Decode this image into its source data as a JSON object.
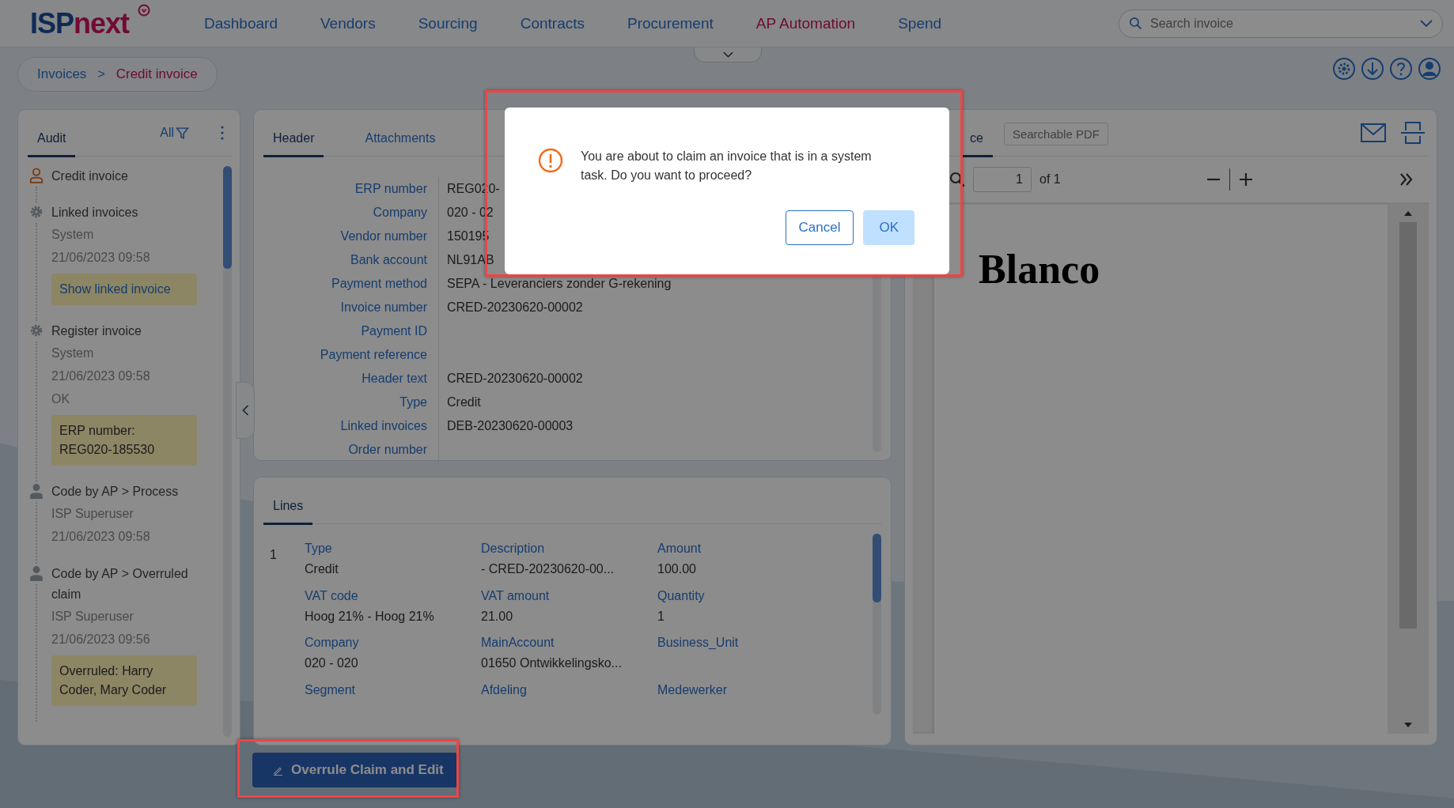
{
  "logo": {
    "brand": "ISP",
    "suffix": "next"
  },
  "nav": [
    {
      "label": "Dashboard",
      "selected": false
    },
    {
      "label": "Vendors",
      "selected": false
    },
    {
      "label": "Sourcing",
      "selected": false
    },
    {
      "label": "Contracts",
      "selected": false
    },
    {
      "label": "Procurement",
      "selected": false
    },
    {
      "label": "AP Automation",
      "selected": true
    },
    {
      "label": "Spend",
      "selected": false
    }
  ],
  "search": {
    "placeholder": "Search invoice"
  },
  "breadcrumb": [
    {
      "label": "Invoices",
      "selected": false
    },
    {
      "label": "Credit invoice",
      "selected": true
    }
  ],
  "breadcrumb_separator": ">",
  "audit": {
    "tab": "Audit",
    "filter": "All",
    "items": [
      {
        "kind": "user",
        "title": "Credit invoice"
      },
      {
        "kind": "system",
        "title": "Linked invoices",
        "lines": [
          "System",
          "21/06/2023 09:58"
        ],
        "note": {
          "kind": "link",
          "text": "Show linked invoice"
        }
      },
      {
        "kind": "system",
        "title": "Register invoice",
        "lines": [
          "System",
          "21/06/2023 09:58",
          "OK"
        ],
        "note": {
          "kind": "text",
          "text": "ERP number: REG020-185530"
        }
      },
      {
        "kind": "person",
        "title": "Code by AP > Process",
        "lines": [
          "ISP Superuser",
          "21/06/2023 09:58"
        ]
      },
      {
        "kind": "person",
        "title": "Code by AP > Overruled claim",
        "lines": [
          "ISP Superuser",
          "21/06/2023 09:56"
        ],
        "note": {
          "kind": "text",
          "text": "Overruled: Harry Coder, Mary Coder"
        }
      }
    ]
  },
  "header_panel": {
    "tabs": [
      {
        "label": "Header",
        "selected": true
      },
      {
        "label": "Attachments",
        "selected": false
      }
    ],
    "fields": [
      {
        "label": "ERP number",
        "value": "REG020-"
      },
      {
        "label": "Company",
        "value": "020 - 02"
      },
      {
        "label": "Vendor number",
        "value": "150195"
      },
      {
        "label": "Bank account",
        "value": "NL91AB"
      },
      {
        "label": "Payment method",
        "value": "SEPA - Leveranciers zonder G-rekening"
      },
      {
        "label": "Invoice number",
        "value": "CRED-20230620-00002"
      },
      {
        "label": "Payment ID"
      },
      {
        "label": "Payment reference"
      },
      {
        "label": "Header text",
        "value": "CRED-20230620-00002"
      },
      {
        "label": "Type",
        "value": "Credit"
      },
      {
        "label": "Linked invoices",
        "value": "DEB-20230620-00003"
      },
      {
        "label": "Order number"
      }
    ]
  },
  "lines_panel": {
    "tab": "Lines",
    "rows": [
      {
        "number": "1",
        "fields": [
          {
            "label": "Type",
            "value": "Credit"
          },
          {
            "label": "Description",
            "value": "- CRED-20230620-00..."
          },
          {
            "label": "Amount",
            "value": "100.00"
          },
          {
            "label": "VAT code",
            "value": "Hoog 21% - Hoog 21%"
          },
          {
            "label": "VAT amount",
            "value": "21.00"
          },
          {
            "label": "Quantity",
            "value": "1"
          },
          {
            "label": "Company",
            "value": "020 - 020"
          },
          {
            "label": "MainAccount",
            "value": "01650 Ontwikkelingsko..."
          },
          {
            "label": "Business_Unit"
          },
          {
            "label": "Segment"
          },
          {
            "label": "Afdeling"
          },
          {
            "label": "Medewerker"
          }
        ]
      }
    ]
  },
  "overrule_button": "Overrule Claim and Edit",
  "pdf_panel": {
    "tabs": [
      {
        "label": "ce",
        "selected": true
      },
      {
        "label": "Searchable PDF",
        "selected": false
      }
    ],
    "page": "1",
    "page_count": "of 1",
    "document_text": "Blanco"
  },
  "dialog": {
    "message": "You are about to claim an invoice that is in a system task. Do you want to proceed?",
    "buttons": [
      {
        "label": "Cancel",
        "kind": "secondary"
      },
      {
        "label": "OK",
        "kind": "primary"
      }
    ]
  }
}
